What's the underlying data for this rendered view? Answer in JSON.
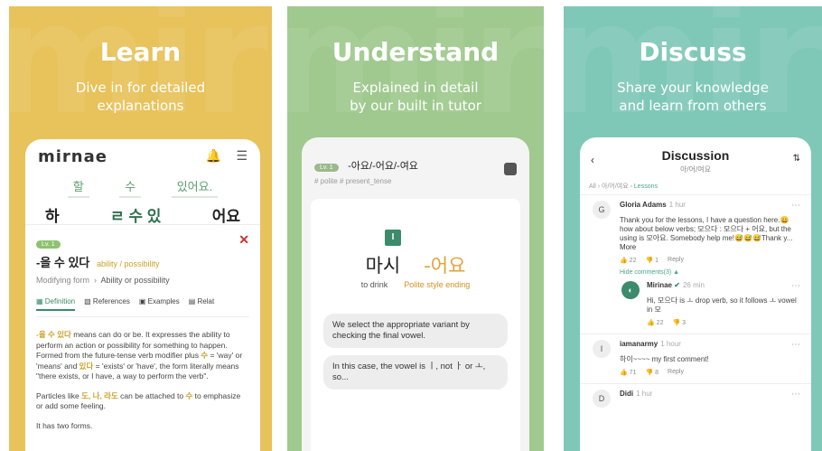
{
  "panels": {
    "learn": {
      "bg_word": "mirnae",
      "title": "Learn",
      "subtitle": "Dive in for detailed\nexplanations",
      "logo": "mirnae",
      "korean_top": [
        "할",
        "수",
        "있어요."
      ],
      "korean_main": [
        "하",
        "ㄹ 수 있",
        "어요"
      ],
      "level": "Lv. 1",
      "grammar": "-을 수 있다",
      "grammar_tag": "ability / possibility",
      "form_label": "Modifying form",
      "form_value": "Ability or possibility",
      "tabs": [
        "Definition",
        "References",
        "Examples",
        "Relat"
      ],
      "para1_k1": "-을 수 있다",
      "para1": " means can do or be. It expresses the ability to perform an action or possibility for something to happen. Formed from the future-tense verb modifier plus ",
      "para1_k2": "수",
      "para1_b": " = 'way' or 'means' and ",
      "para1_k3": "있다",
      "para1_c": " = 'exists' or 'have', the form literally means \"there exists, or I have, a way to perform the verb\".",
      "para2_a": "Particles like ",
      "para2_k": "도, 나, 라도",
      "para2_b": " can be attached to ",
      "para2_k2": "수",
      "para2_c": " to emphasize or add some feeling.",
      "para3": "It has two forms."
    },
    "understand": {
      "bg_word": "mirae",
      "title": "Understand",
      "subtitle": "Explained in detail\nby our built in tutor",
      "level": "Lv. 1",
      "grammar": "-아요/-어요/-여요",
      "tags": "# polite  # present_tense",
      "marker": "I",
      "verb": "마시",
      "ending": "-어요",
      "verb_label": "to drink",
      "ending_label": "Polite style ending",
      "bubble1": "We select the appropriate variant by checking the final vowel.",
      "bubble2": "In this case, the vowel is ㅣ, not ㅏ or ㅗ, so..."
    },
    "discuss": {
      "bg_word": "mirae",
      "title": "Discuss",
      "subtitle": "Share your knowledge\nand learn from others",
      "header": "Discussion",
      "header_sub": "아/어/여요",
      "crumb_all": "All",
      "crumb_mid": "아/어/여요",
      "crumb_lessons": "Lessons",
      "comments": [
        {
          "avatar": "G",
          "name": "Gloria Adams",
          "time": "1 hur",
          "text": "Thank you for the lessons, I have a question here.😀 how about below verbs; 모으다 : 모으다 + 어요, but the using is 모아요. Somebody help me!😅😅😅Thank y...",
          "more": "More",
          "likes": "22",
          "dislikes": "1",
          "reply": "Reply",
          "hide": "Hide comments(3)"
        },
        {
          "avatar": "I",
          "name": "iamanarmy",
          "time": "1 hour",
          "text": "하이~~~~ my first comment!",
          "likes": "71",
          "dislikes": "8",
          "reply": "Reply"
        },
        {
          "avatar": "D",
          "name": "Didi",
          "time": "1 hur"
        }
      ],
      "reply": {
        "name": "Mirinae",
        "time": "26 min",
        "text": "Hi, 모으다 is ㅗ drop verb, so it follows ㅗ vowel in 모",
        "likes": "22",
        "dislikes": "3"
      }
    }
  }
}
